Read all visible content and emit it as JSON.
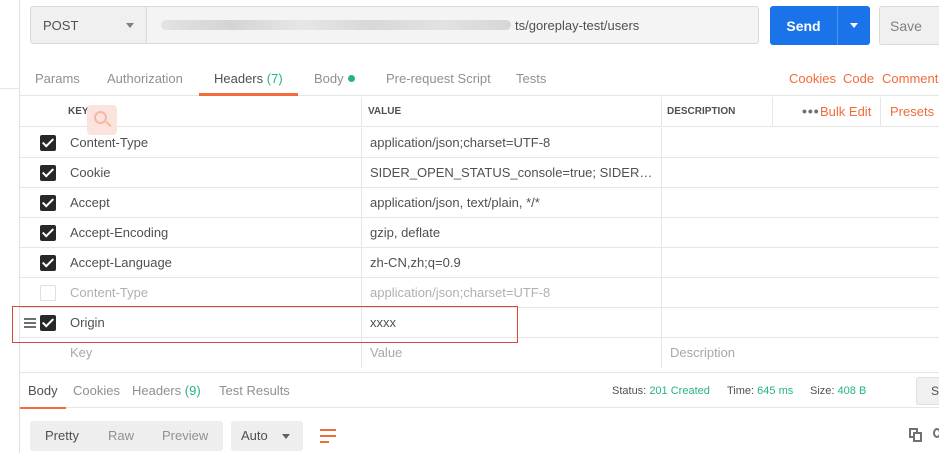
{
  "request": {
    "method": "POST",
    "url_visible": "ts/goreplay-test/users",
    "send_label": "Send",
    "save_label": "Save"
  },
  "request_tabs": [
    {
      "label": "Params"
    },
    {
      "label": "Authorization"
    },
    {
      "label": "Headers",
      "count": "(7)"
    },
    {
      "label": "Body"
    },
    {
      "label": "Pre-request Script"
    },
    {
      "label": "Tests"
    }
  ],
  "request_links": {
    "cookies": "Cookies",
    "code": "Code",
    "comments": "Comments"
  },
  "headers_table": {
    "columns": {
      "key": "KEY",
      "value": "VALUE",
      "description": "DESCRIPTION"
    },
    "more": "•••",
    "bulk_edit": "Bulk Edit",
    "presets": "Presets",
    "rows": [
      {
        "key": "Content-Type",
        "value": "application/json;charset=UTF-8",
        "checked": true
      },
      {
        "key": "Cookie",
        "value": "SIDER_OPEN_STATUS_console=true; SIDER_OPEN...",
        "checked": true
      },
      {
        "key": "Accept",
        "value": "application/json, text/plain, */*",
        "checked": true
      },
      {
        "key": "Accept-Encoding",
        "value": "gzip, deflate",
        "checked": true
      },
      {
        "key": "Accept-Language",
        "value": "zh-CN,zh;q=0.9",
        "checked": true
      },
      {
        "key": "Content-Type",
        "value": "application/json;charset=UTF-8",
        "checked": false
      },
      {
        "key": "Origin",
        "value": "xxxx",
        "checked": true
      }
    ],
    "placeholders": {
      "key": "Key",
      "value": "Value",
      "description": "Description"
    }
  },
  "response": {
    "tabs": [
      {
        "label": "Body"
      },
      {
        "label": "Cookies"
      },
      {
        "label": "Headers",
        "count": "(9)"
      },
      {
        "label": "Test Results"
      }
    ],
    "status_label": "Status:",
    "status_value": "201 Created",
    "time_label": "Time:",
    "time_value": "645 ms",
    "size_label": "Size:",
    "size_value": "408 B",
    "save_label": "Save",
    "view_modes": [
      "Pretty",
      "Raw",
      "Preview"
    ],
    "format": "Auto"
  },
  "colors": {
    "accent": "#f26b3a",
    "send": "#1a73e8",
    "success": "#26b47f"
  }
}
